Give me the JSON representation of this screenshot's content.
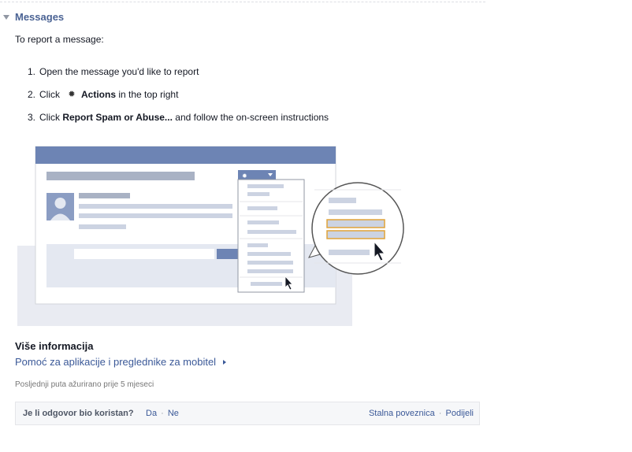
{
  "section": {
    "title": "Messages"
  },
  "intro": "To report a message:",
  "steps": [
    {
      "num": "1.",
      "text": "Open the message you'd like to report"
    },
    {
      "num": "2.",
      "pre": "Click",
      "bold": "Actions",
      "post": "in the top right",
      "icon": "gear-icon"
    },
    {
      "num": "3.",
      "pre": "Click",
      "bold": "Report Spam or Abuse...",
      "post": "and follow the on-screen instructions"
    }
  ],
  "more_info": {
    "heading": "Više informacija",
    "link": "Pomoć za aplikacije i preglednike za mobitel"
  },
  "updated": "Posljednji puta ažurirano prije 5 mjeseci",
  "feedback": {
    "question": "Je li odgovor bio koristan?",
    "yes": "Da",
    "separator": "·",
    "no": "Ne",
    "permalink": "Stalna poveznica",
    "share": "Podijeli"
  },
  "colors": {
    "link": "#3b5998",
    "header": "#4b6394",
    "illustration_bar": "#6d84b4",
    "highlight": "#e0a339"
  }
}
